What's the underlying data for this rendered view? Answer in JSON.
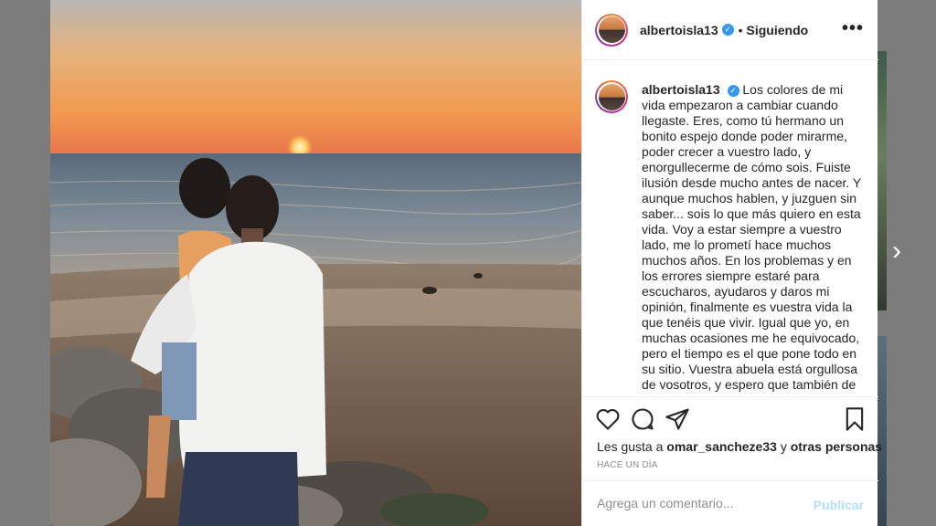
{
  "post": {
    "username": "albertoisla13",
    "following_label": "Siguiendo",
    "separator": "•",
    "verified_glyph": "✓",
    "more_label": "•••",
    "caption": "Los colores de mi vida empezaron a cambiar cuando llegaste. Eres, como tú hermano un bonito espejo donde poder mirarme, poder crecer a vuestro lado, y enorgullecerme de cómo sois. Fuiste ilusión desde mucho antes de nacer. Y aunque muchos hablen, y juzguen sin saber... sois lo que más quiero en esta vida. Voy a estar siempre a vuestro lado, me lo prometí hace muchos muchos años. En los problemas y en los errores siempre estaré para escucharos, ayudaros y daros mi opinión, finalmente es vuestra vida la que tenéis que vivir. Igual que yo, en muchas ocasiones me he equivocado, pero el tiempo es el que pone todo en su sitio. Vuestra abuela está orgullosa de vosotros, y espero que también de",
    "likes_prefix": "Les gusta a",
    "likes_user": "omar_sanchezе33",
    "likes_joiner": "y",
    "likes_others": "otras personas",
    "time_ago": "HACE UN DÍA"
  },
  "comment": {
    "placeholder": "Agrega un comentario...",
    "publish_label": "Publicar"
  },
  "nav": {
    "next_glyph": "›"
  },
  "icons": [
    "heart-icon",
    "comment-icon",
    "share-icon",
    "bookmark-icon",
    "verified-icon",
    "more-icon",
    "chevron-right-icon"
  ],
  "colors": {
    "link_blue": "#3897f0",
    "publish_disabled": "#b2dffc",
    "text": "#262626",
    "muted": "#8e8e8e"
  }
}
